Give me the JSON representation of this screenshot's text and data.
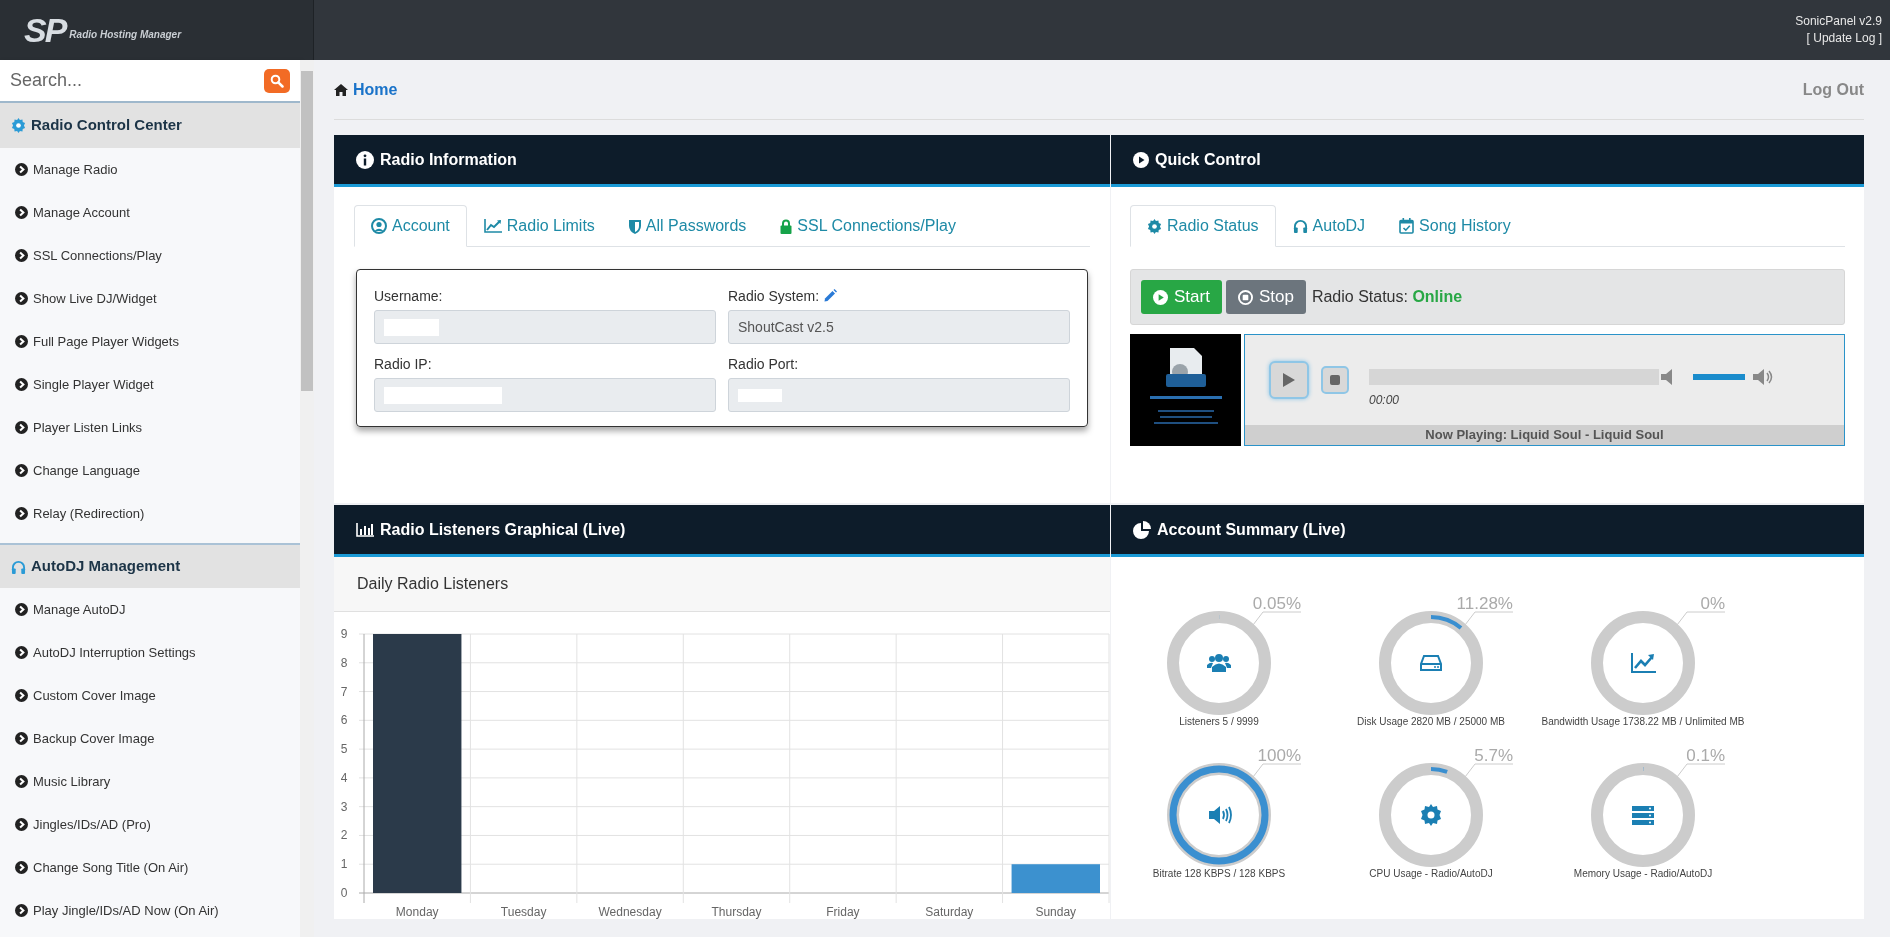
{
  "header": {
    "logo_mark": "SP",
    "logo_text": "Radio Hosting Manager",
    "version": "SonicPanel v2.9",
    "update_log": "[ Update Log ]"
  },
  "sidebar": {
    "search": {
      "placeholder": "Search..."
    },
    "sections": [
      {
        "title": "Radio Control Center",
        "items": [
          "Manage Radio",
          "Manage Account",
          "SSL Connections/Play",
          "Show Live DJ/Widget",
          "Full Page Player Widgets",
          "Single Player Widget",
          "Player Listen Links",
          "Change Language",
          "Relay (Redirection)"
        ]
      },
      {
        "title": "AutoDJ Management",
        "items": [
          "Manage AutoDJ",
          "AutoDJ Interruption Settings",
          "Custom Cover Image",
          "Backup Cover Image",
          "Music Library",
          "Jingles/IDs/AD (Pro)",
          "Change Song Title (On Air)",
          "Play Jingle/IDs/AD Now (On Air)"
        ]
      }
    ]
  },
  "breadcrumb": "Home",
  "logout": "Log Out",
  "radio_information": {
    "title": "Radio Information",
    "tabs": [
      {
        "label": "Account",
        "selected": true
      },
      {
        "label": "Radio Limits",
        "selected": false
      },
      {
        "label": "All Passwords",
        "selected": false
      },
      {
        "label": "SSL Connections/Play",
        "selected": false
      }
    ],
    "fields": [
      {
        "label": "Username:",
        "redacted": true
      },
      {
        "label": "Radio System:",
        "value": "ShoutCast v2.5",
        "editable": true
      },
      {
        "label": "Radio IP:",
        "redacted": true
      },
      {
        "label": "Radio Port:",
        "redacted": true
      }
    ]
  },
  "quick_control": {
    "title": "Quick Control",
    "tabs": [
      {
        "label": "Radio Status",
        "selected": true
      },
      {
        "label": "AutoDJ",
        "selected": false
      },
      {
        "label": "Song History",
        "selected": false
      }
    ],
    "start_button": "Start",
    "stop_button": "Stop",
    "status_label": "Radio Status:",
    "status_value": "Online",
    "online": true,
    "player": {
      "time": "00:00",
      "volume": {
        "level": 1
      },
      "now_playing": "Now Playing: Liquid Soul - Liquid Soul"
    }
  },
  "listeners_chart": {
    "title": "Radio Listeners Graphical (Live)",
    "chart_data": {
      "type": "bar",
      "title": "Daily Radio Listeners",
      "categories": [
        "Monday",
        "Tuesday",
        "Wednesday",
        "Thursday",
        "Friday",
        "Saturday",
        "Sunday"
      ],
      "series": [
        {
          "color": "#2b3a4a",
          "values": [
            9,
            0,
            0,
            0,
            0,
            0,
            null
          ]
        },
        {
          "color": "#3c91cf",
          "values": [
            null,
            null,
            null,
            null,
            null,
            null,
            1
          ]
        }
      ],
      "stacked": true,
      "grid": true,
      "ylim": [
        0,
        9
      ],
      "yticks": [
        0,
        1,
        2,
        3,
        4,
        5,
        6,
        7,
        8,
        9
      ]
    }
  },
  "account_summary": {
    "title": "Account Summary (Live)",
    "gauges": [
      {
        "percent": "0.05%",
        "level": 0.0005,
        "caption": "Listeners 5 / 9999"
      },
      {
        "percent": "11.28%",
        "level": 0.1128,
        "caption": "Disk Usage 2820 MB / 25000 MB"
      },
      {
        "percent": "0%",
        "level": 0,
        "caption": "Bandwidth Usage 1738.22 MB / Unlimited MB"
      },
      {
        "percent": "100%",
        "level": 1,
        "caption": "Bitrate 128 KBPS / 128 KBPS"
      },
      {
        "percent": "5.7%",
        "level": 0.057,
        "caption": "CPU Usage - Radio/AutoDJ"
      },
      {
        "percent": "0.1%",
        "level": 0.001,
        "caption": "Memory Usage - Radio/AutoDJ"
      }
    ]
  }
}
